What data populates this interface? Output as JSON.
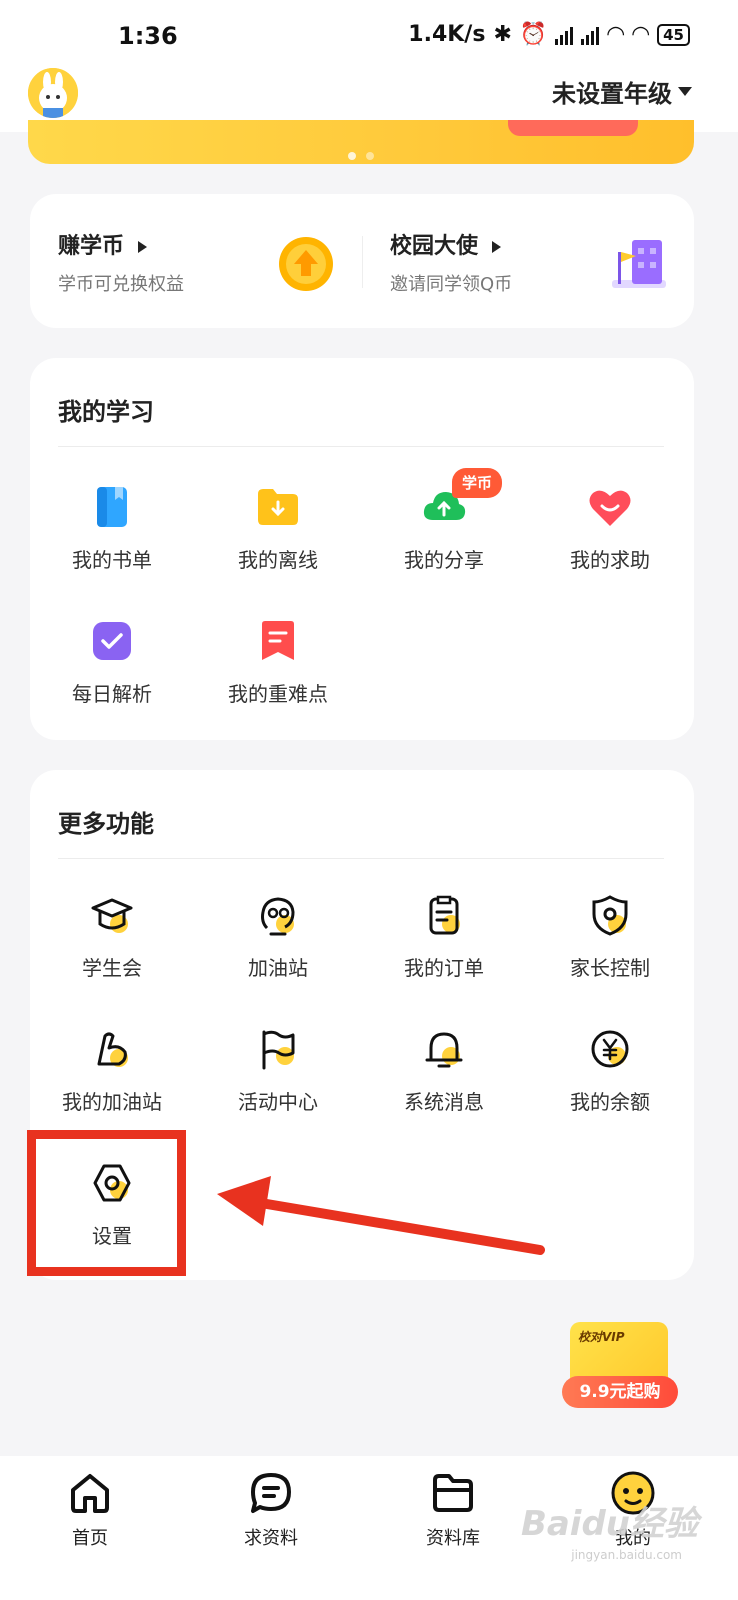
{
  "status_bar": {
    "time": "1:36",
    "speed": "1.4K/s",
    "battery": "45"
  },
  "header": {
    "grade_selector": "未设置年级"
  },
  "earn": {
    "coins_title": "赚学币",
    "coins_sub": "学币可兑换权益",
    "ambassador_title": "校园大使",
    "ambassador_sub": "邀请同学领Q币"
  },
  "my_study": {
    "title": "我的学习",
    "items": [
      {
        "label": "我的书单",
        "icon": "book-icon"
      },
      {
        "label": "我的离线",
        "icon": "folder-download-icon"
      },
      {
        "label": "我的分享",
        "icon": "cloud-upload-icon",
        "badge": "学币"
      },
      {
        "label": "我的求助",
        "icon": "heart-smile-icon"
      },
      {
        "label": "每日解析",
        "icon": "check-badge-icon"
      },
      {
        "label": "我的重难点",
        "icon": "bookmark-note-icon"
      }
    ]
  },
  "more_functions": {
    "title": "更多功能",
    "items": [
      {
        "label": "学生会",
        "icon": "graduation-cap-icon"
      },
      {
        "label": "加油站",
        "icon": "face-glasses-icon"
      },
      {
        "label": "我的订单",
        "icon": "clipboard-icon"
      },
      {
        "label": "家长控制",
        "icon": "shield-face-icon"
      },
      {
        "label": "我的加油站",
        "icon": "flexed-arm-icon"
      },
      {
        "label": "活动中心",
        "icon": "flag-icon"
      },
      {
        "label": "系统消息",
        "icon": "bell-icon"
      },
      {
        "label": "我的余额",
        "icon": "yen-coin-icon"
      },
      {
        "label": "设置",
        "icon": "settings-hex-icon"
      }
    ]
  },
  "vip": {
    "tag": "校对VIP",
    "price": "9.9元起购"
  },
  "bottom_nav": [
    {
      "label": "首页",
      "icon": "home-icon"
    },
    {
      "label": "求资料",
      "icon": "chat-request-icon"
    },
    {
      "label": "资料库",
      "icon": "folder-library-icon"
    },
    {
      "label": "我的",
      "icon": "profile-face-icon",
      "active": true
    }
  ],
  "watermark": {
    "main": "Baidu经验",
    "sub": "jingyan.baidu.com"
  },
  "colors": {
    "accent": "#ffc93a",
    "highlight": "#e8321f"
  }
}
